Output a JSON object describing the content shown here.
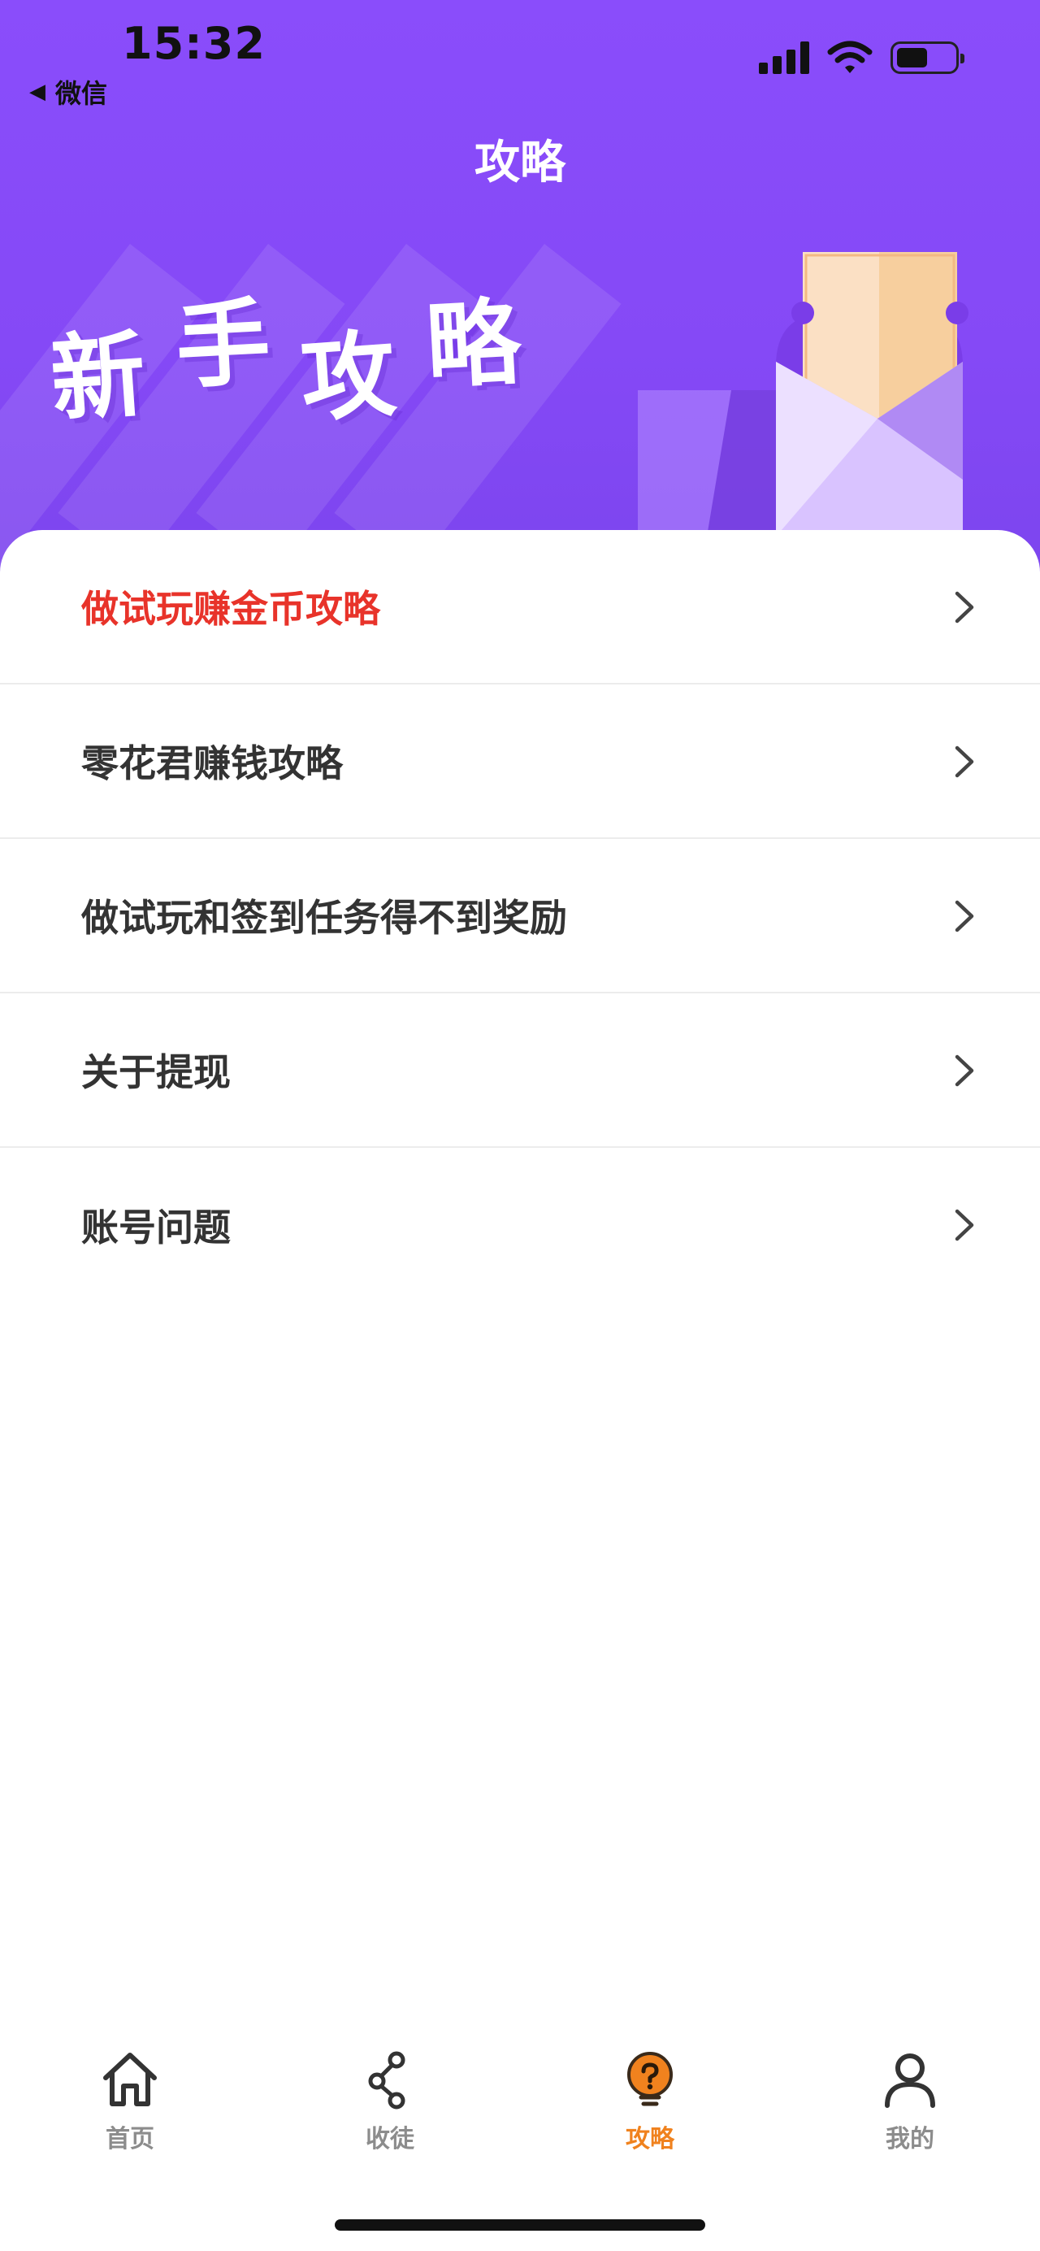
{
  "status_bar": {
    "time": "15:32",
    "back_label": "微信"
  },
  "header": {
    "title": "攻略"
  },
  "banner": {
    "chars": [
      "新",
      "手",
      "攻",
      "略"
    ]
  },
  "list": {
    "items": [
      {
        "label": "做试玩赚金币攻略",
        "highlight": true
      },
      {
        "label": "零花君赚钱攻略",
        "highlight": false
      },
      {
        "label": "做试玩和签到任务得不到奖励",
        "highlight": false
      },
      {
        "label": "关于提现",
        "highlight": false
      },
      {
        "label": "账号问题",
        "highlight": false
      }
    ]
  },
  "tabbar": {
    "tabs": [
      {
        "label": "首页",
        "icon": "home-icon",
        "active": false
      },
      {
        "label": "收徒",
        "icon": "share-icon",
        "active": false
      },
      {
        "label": "攻略",
        "icon": "help-bulb-icon",
        "active": true
      },
      {
        "label": "我的",
        "icon": "user-icon",
        "active": false
      }
    ]
  },
  "colors": {
    "header_purple": "#8a4dfb",
    "highlight_red": "#e8332a",
    "active_orange": "#f0821e",
    "inactive_gray": "#8c8c8c"
  }
}
